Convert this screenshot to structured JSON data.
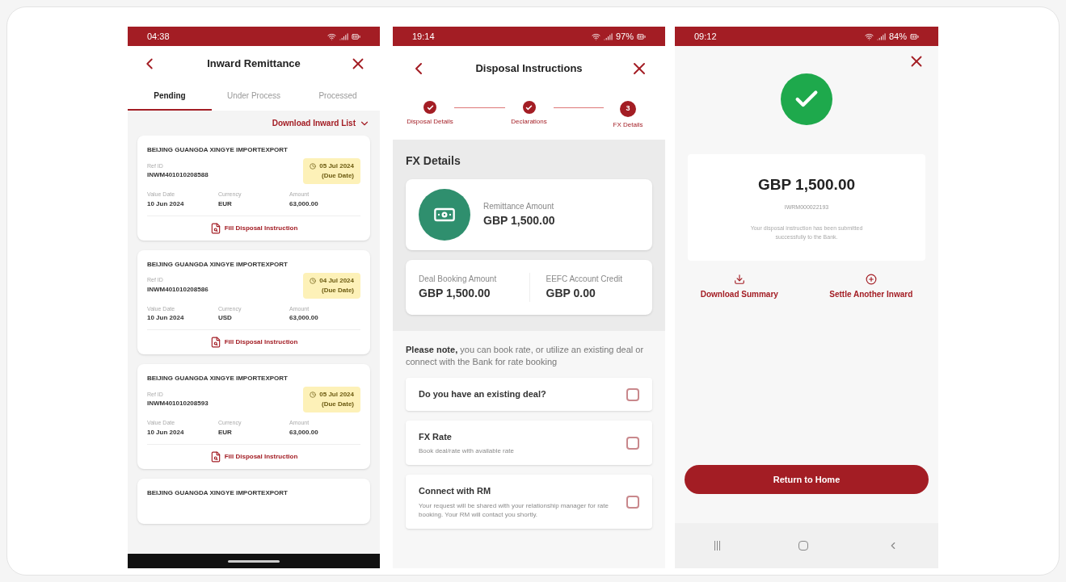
{
  "inward_screen": {
    "status_bar": {
      "time": "04:38"
    },
    "title": "Inward Remittance",
    "tabs": [
      {
        "label": "Pending",
        "selected": true
      },
      {
        "label": "Under Process",
        "selected": false
      },
      {
        "label": "Processed",
        "selected": false
      }
    ],
    "download_link": "Download Inward List",
    "cards": [
      {
        "name": "BEIJING GUANGDA XINGYE IMPORTEXPORT",
        "ref_label": "Ref ID",
        "ref": "INWM401010208588",
        "due": "05 Jul 2024",
        "due_note": "(Due Date)",
        "fields": [
          {
            "label": "Value Date",
            "value": "10 Jun 2024"
          },
          {
            "label": "Currency",
            "value": "EUR"
          },
          {
            "label": "Amount",
            "value": "63,000.00"
          }
        ],
        "action": "Fill Disposal Instruction"
      },
      {
        "name": "BEIJING GUANGDA XINGYE IMPORTEXPORT",
        "ref_label": "Ref ID",
        "ref": "INWM401010208586",
        "due": "04 Jul 2024",
        "due_note": "(Due Date)",
        "fields": [
          {
            "label": "Value Date",
            "value": "10 Jun 2024"
          },
          {
            "label": "Currency",
            "value": "USD"
          },
          {
            "label": "Amount",
            "value": "63,000.00"
          }
        ],
        "action": "Fill Disposal Instruction"
      },
      {
        "name": "BEIJING GUANGDA XINGYE IMPORTEXPORT",
        "ref_label": "Ref ID",
        "ref": "INWM401010208593",
        "due": "05 Jul 2024",
        "due_note": "(Due Date)",
        "fields": [
          {
            "label": "Value Date",
            "value": "10 Jun 2024"
          },
          {
            "label": "Currency",
            "value": "EUR"
          },
          {
            "label": "Amount",
            "value": "63,000.00"
          }
        ],
        "action": "Fill Disposal Instruction"
      },
      {
        "name": "BEIJING GUANGDA XINGYE IMPORTEXPORT"
      }
    ]
  },
  "disposal_screen": {
    "status_bar": {
      "time": "19:14",
      "battery": "97%"
    },
    "title": "Disposal Instructions",
    "steps": [
      {
        "label": "Disposal Details",
        "completed": true
      },
      {
        "label": "Declarations",
        "completed": true
      },
      {
        "label": "FX Details",
        "completed": false,
        "number": "3"
      }
    ],
    "section_title": "FX Details",
    "remittance": {
      "label": "Remittance Amount",
      "value": "GBP 1,500.00"
    },
    "amounts": [
      {
        "label": "Deal Booking Amount",
        "value": "GBP 1,500.00"
      },
      {
        "label": "EEFC Account Credit",
        "value": "GBP 0.00"
      }
    ],
    "note": "**Please note,** you can book rate, or utilize an existing deal or connect with the Bank for rate booking",
    "options": [
      {
        "title": "Do you have an existing deal?",
        "checked": false
      },
      {
        "title": "FX Rate",
        "subtitle": "Book deal/rate with available rate",
        "checked": false
      },
      {
        "title": "Connect with RM",
        "subtitle": "Your request will be shared with your relationship manager for rate booking. Your RM will contact you shortly.",
        "checked": false
      }
    ]
  },
  "success_screen": {
    "status_bar": {
      "time": "09:12",
      "battery": "84%"
    },
    "amount": "GBP 1,500.00",
    "reference": "IWRM000022193",
    "message": "Your disposal instruction has been submitted successfully to the Bank.",
    "actions": [
      {
        "kind": "download",
        "label": "Download Summary"
      },
      {
        "kind": "settle",
        "label": "Settle Another Inward"
      }
    ],
    "button": "Return to Home"
  }
}
